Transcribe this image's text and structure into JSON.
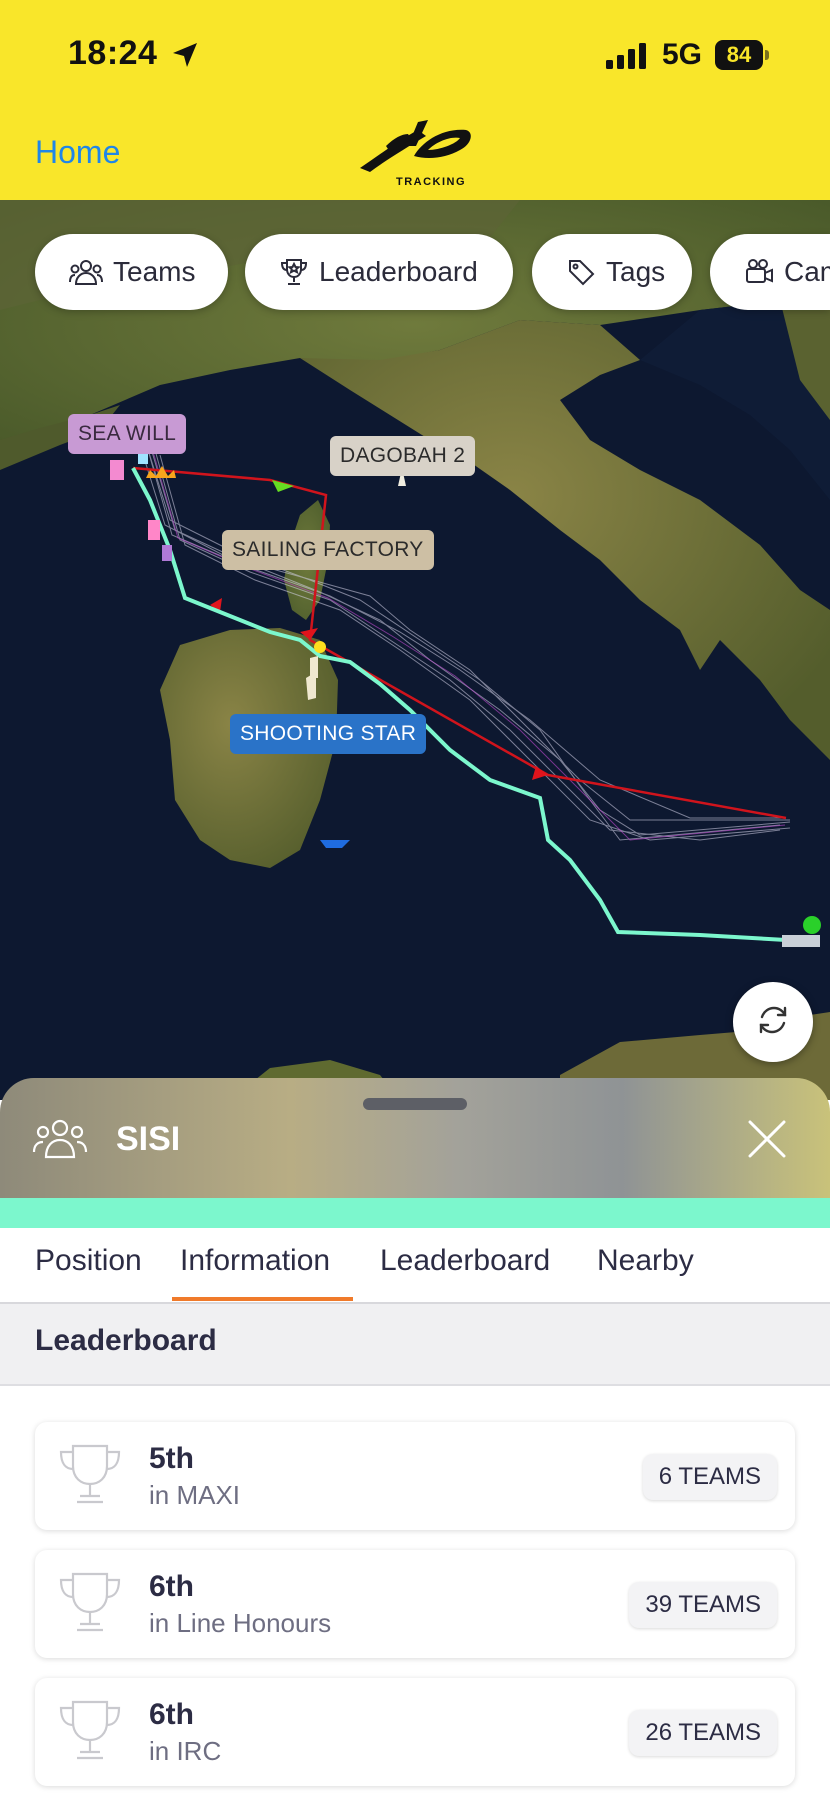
{
  "status_bar": {
    "time": "18:24",
    "network": "5G",
    "battery": "84"
  },
  "header": {
    "home_label": "Home",
    "logo_text": "TRACKING"
  },
  "map": {
    "filter_chips": [
      {
        "label": "Teams",
        "icon": "users-icon"
      },
      {
        "label": "Leaderboard",
        "icon": "trophy-icon"
      },
      {
        "label": "Tags",
        "icon": "tag-icon"
      },
      {
        "label": "Cameras",
        "icon": "camera-icon"
      }
    ],
    "boat_labels": [
      {
        "label": "SEA WILL"
      },
      {
        "label": "DAGOBAH 2"
      },
      {
        "label": "SAILING FACTORY"
      },
      {
        "label": "SHOOTING STAR"
      }
    ]
  },
  "team_sheet": {
    "team_name": "SISI",
    "team_color": "#7cf7cd",
    "tabs": [
      "Position",
      "Information",
      "Leaderboard",
      "Nearby"
    ],
    "active_tab": "Information",
    "section_title": "Leaderboard",
    "rankings": [
      {
        "rank": "5th",
        "class": "in MAXI",
        "teams": "6 TEAMS"
      },
      {
        "rank": "6th",
        "class": "in Line Honours",
        "teams": "39 TEAMS"
      },
      {
        "rank": "6th",
        "class": "in IRC",
        "teams": "26 TEAMS"
      }
    ]
  },
  "colors": {
    "header_yellow": "#f9e62a",
    "link_blue": "#1f86e8",
    "tab_accent": "#f07a2a",
    "course_red": "#d0141c"
  }
}
